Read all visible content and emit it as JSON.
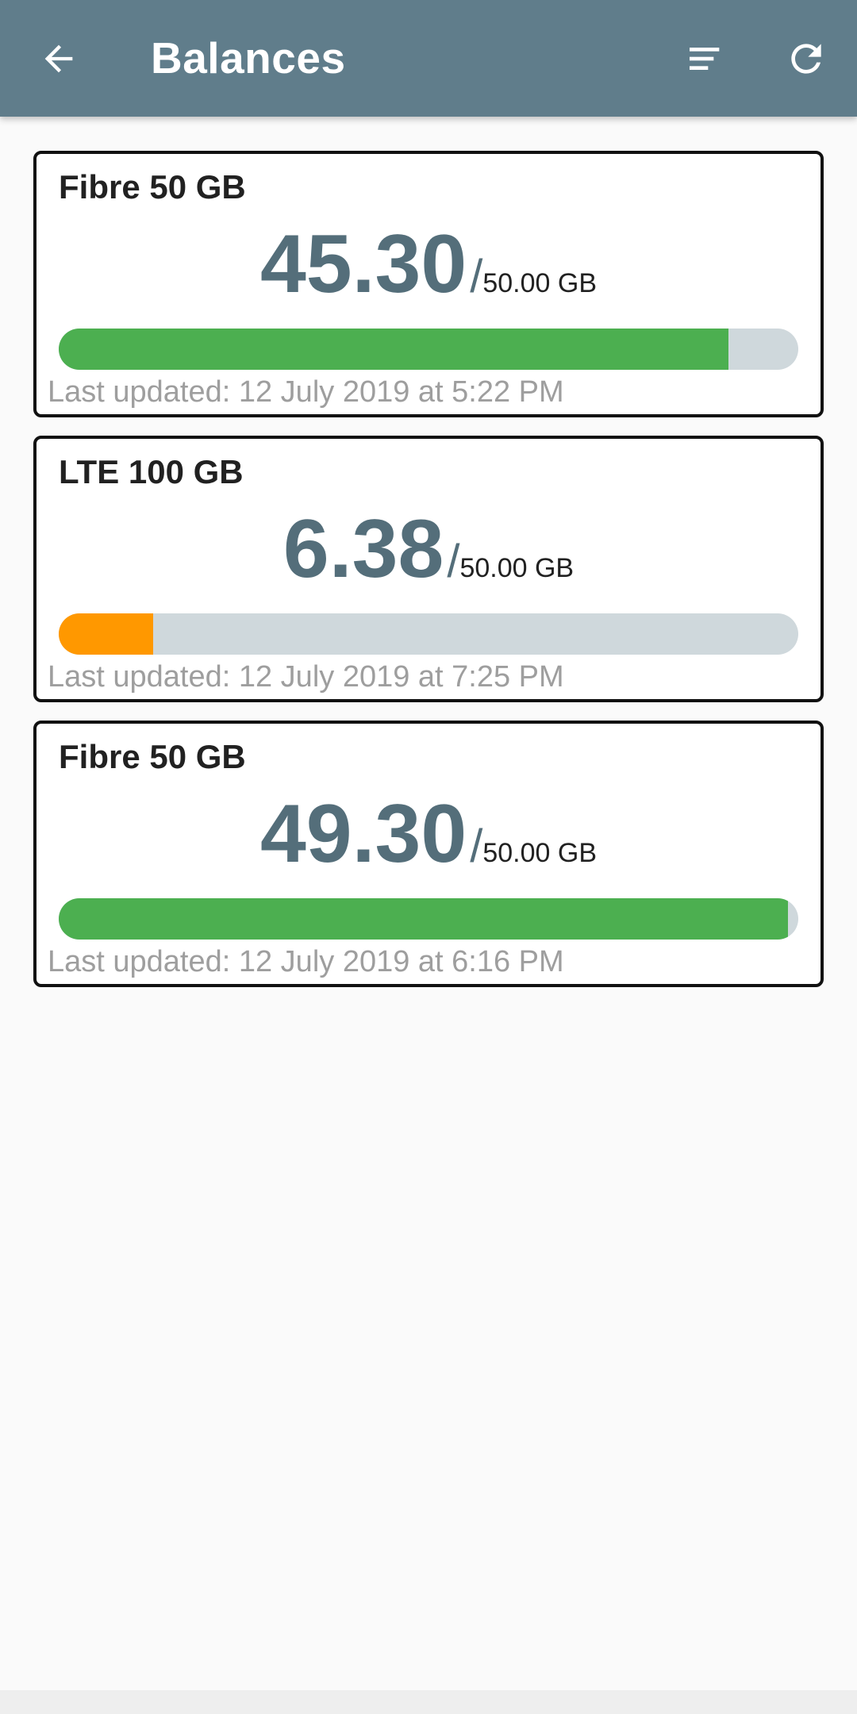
{
  "appbar": {
    "title": "Balances",
    "background": "#607d8b",
    "icons": [
      "back-arrow-icon",
      "sort-icon",
      "refresh-icon"
    ]
  },
  "balances": [
    {
      "name": "Fibre 50 GB",
      "amount": "45.30",
      "slash": "/",
      "total": "50.00 GB",
      "fill_fraction": 0.906,
      "bar_color": "#4caf50",
      "updated": "Last updated: 12 July 2019 at 5:22 PM"
    },
    {
      "name": "LTE 100 GB",
      "amount": "6.38",
      "slash": "/",
      "total": "50.00 GB",
      "fill_fraction": 0.1276,
      "bar_color": "#ff9800",
      "updated": "Last updated: 12 July 2019 at 7:25 PM"
    },
    {
      "name": "Fibre 50 GB",
      "amount": "49.30",
      "slash": "/",
      "total": "50.00 GB",
      "fill_fraction": 0.986,
      "bar_color": "#4caf50",
      "updated": "Last updated: 12 July 2019 at 6:16 PM"
    }
  ],
  "colors": {
    "track": "#cfd8dc",
    "amount": "#546e7a",
    "muted_text": "#9e9e9e"
  }
}
